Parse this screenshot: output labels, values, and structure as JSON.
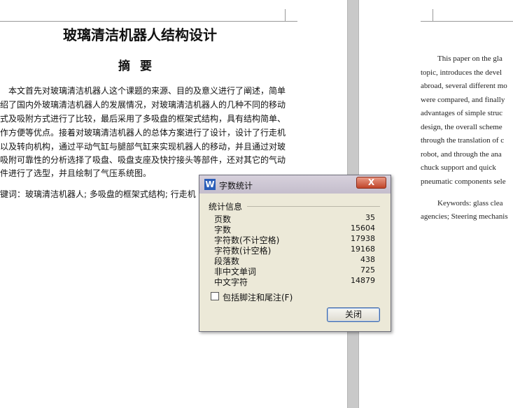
{
  "document": {
    "title": "玻璃清洁机器人结构设计",
    "abstract_heading": "摘要",
    "abstract_lines": [
      "本文首先对玻璃清洁机器人这个课题的来源、目的及意义进行了阐述，简单",
      "介绍了国内外玻璃清洁机器人的发展情况，对玻璃清洁机器人的几种不同的移动",
      "方式及吸附方式进行了比较，最后采用了多吸盘的框架式结构，具有结构简单、",
      "操作方便等优点。接着对玻璃清洁机器人的总体方案进行了设计，设计了行走机",
      "构以及转向机构，通过平动气缸与腿部气缸来实现机器人的移动，并且通过对玻",
      "璃吸附可靠性的分析选择了吸盘、吸盘支座及快拧接头等部件，还对其它的气动",
      "元件进行了选型，并且绘制了气压系统图。"
    ],
    "keywords_line": "关键词：玻璃清洁机器人; 多吸盘的框架式结构; 行走机",
    "english_lines": [
      "This paper on the gla",
      "topic, introduces the devel",
      "abroad, several different mo",
      "were compared, and finally",
      "advantages of simple struc",
      "design, the overall scheme",
      "through the translation of c",
      "robot, and through the ana",
      "chuck support and quick",
      "pneumatic components sele",
      "Keywords: glass clea",
      "agencies; Steering mechanis"
    ]
  },
  "dialog": {
    "icon_letter": "W",
    "title": "字数统计",
    "close_x": "X",
    "group_label": "统计信息",
    "stats": [
      {
        "label": "页数",
        "value": "35"
      },
      {
        "label": "字数",
        "value": "15604"
      },
      {
        "label": "字符数(不计空格)",
        "value": "17938"
      },
      {
        "label": "字符数(计空格)",
        "value": "19168"
      },
      {
        "label": "段落数",
        "value": "438"
      },
      {
        "label": "非中文单词",
        "value": "725"
      },
      {
        "label": "中文字符",
        "value": "14879"
      }
    ],
    "checkbox_label": "包括脚注和尾注(F)",
    "checkbox_checked": false,
    "close_button": "关闭"
  }
}
